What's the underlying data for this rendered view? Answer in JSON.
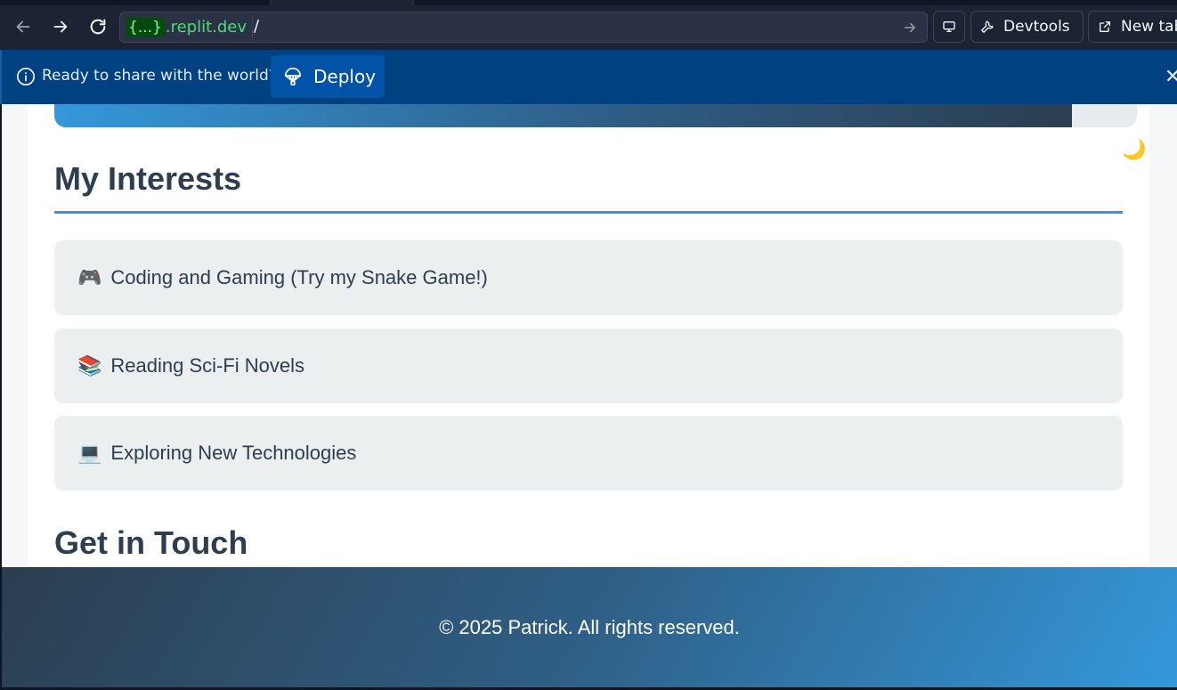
{
  "browser": {
    "url_badge": "{...}",
    "url_host": ".replit.dev",
    "url_path": "/",
    "screen_button_icon": "monitor-icon",
    "devtools_label": "Devtools",
    "newtab_label": "New tab"
  },
  "banner": {
    "message": "Ready to share with the world?",
    "deploy_label": "Deploy",
    "close_glyph": "✕"
  },
  "page": {
    "progress_percent": 94,
    "theme_toggle_glyph": "🌙",
    "interests_title": "My Interests",
    "interests": [
      {
        "emoji": "🎮",
        "label": "Coding and Gaming (Try my Snake Game!)"
      },
      {
        "emoji": "📚",
        "label": "Reading Sci-Fi Novels"
      },
      {
        "emoji": "💻",
        "label": "Exploring New Technologies"
      }
    ],
    "contact_title": "Get in Touch"
  },
  "footer": {
    "text": "© 2025 Patrick. All rights reserved."
  },
  "colors": {
    "accent": "#3498db",
    "heading": "#2c3e50",
    "banner_bg": "#004182",
    "url_green": "#4bdc77"
  }
}
